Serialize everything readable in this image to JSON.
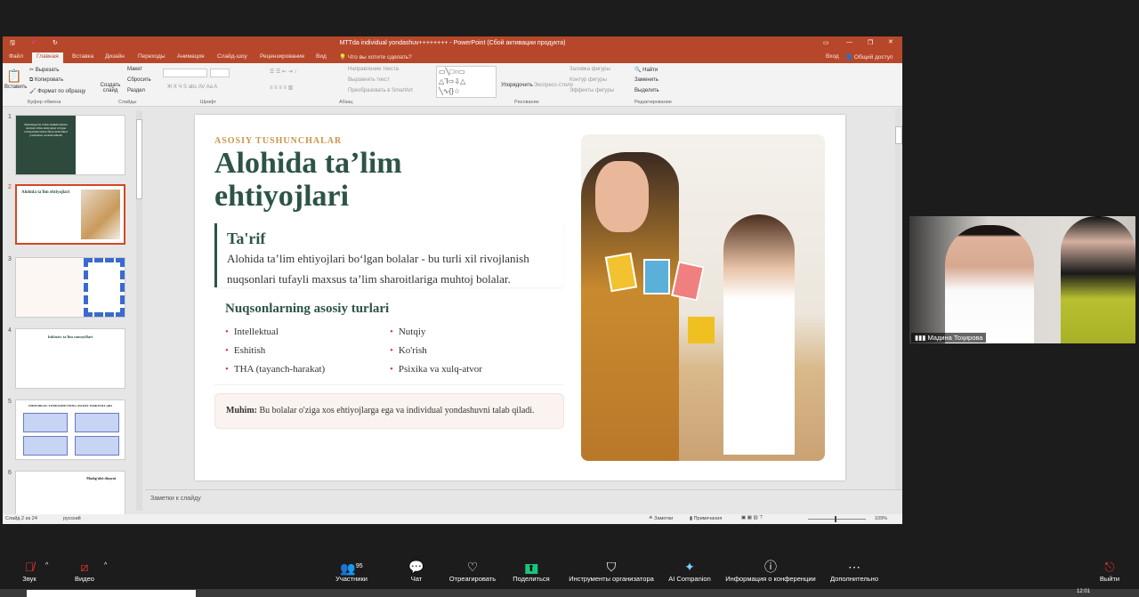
{
  "window": {
    "title": "MTTda individual yondashuv++++++++ - PowerPoint (Сбой активации продукта)",
    "signin": "Вход",
    "share": "Общий доступ"
  },
  "tabs": [
    "Файл",
    "Главная",
    "Вставка",
    "Дизайн",
    "Переходы",
    "Анимация",
    "Слайд-шоу",
    "Рецензирование",
    "Вид"
  ],
  "tell_me": "Что вы хотите сделать?",
  "ribbon": {
    "clipboard": {
      "paste": "Вставить",
      "cut": "Вырезать",
      "copy": "Копировать",
      "format": "Формат по образцу",
      "label": "Буфер обмена"
    },
    "slides": {
      "new": "Создать слайд",
      "layout": "Макет",
      "reset": "Сбросить",
      "section": "Раздел",
      "label": "Слайды"
    },
    "font": {
      "label": "Шрифт"
    },
    "paragraph": {
      "dir": "Направление текста",
      "align": "Выровнять текст",
      "smartart": "Преобразовать в SmartArt",
      "label": "Абзац"
    },
    "drawing": {
      "arrange": "Упорядочить",
      "styles": "Экспресс-стили",
      "fill": "Заливка фигуры",
      "outline": "Контур фигуры",
      "effects": "Эффекты фигуры",
      "label": "Рисование"
    },
    "editing": {
      "find": "Найти",
      "replace": "Заменить",
      "select": "Выделить",
      "label": "Редактирование"
    }
  },
  "thumbnails": [
    {
      "num": "1",
      "title": "Maktabgacha ta'lim tashkilotlarida alohida ta'lim ehtiyojlari bo'lgan tarbiyalanuvchilar bilan individual yondashuv asosida ishlash"
    },
    {
      "num": "2",
      "title": "Alohida ta'lim ehtiyojlari"
    },
    {
      "num": "3",
      "title": ""
    },
    {
      "num": "4",
      "title": "Inkluziv ta'lim tamoyillari"
    },
    {
      "num": "5",
      "title": "INDIVIDUAL YONDASHUVNING ASOSIY TAMOYILLARI"
    },
    {
      "num": "6",
      "title": "Mashg'ulot dizayni"
    }
  ],
  "slide": {
    "kicker": "ASOSIY TUSHUNCHALAR",
    "title_line1": "Alohida ta’lim",
    "title_line2": "ehtiyojlari",
    "def_heading": "Ta'rif",
    "def_line1": "Alohida ta’lim ehtiyojlari bo‘lgan bolalar - bu turli xil rivojlanish",
    "def_line2": "nuqsonlari tufayli maxsus ta’lim sharoitlariga muhtoj bolalar.",
    "types_heading": "Nuqsonlarning asosiy turlari",
    "types_left": [
      "Intellektual",
      "Eshitish",
      "THA (tayanch-harakat)"
    ],
    "types_right": [
      "Nutqiy",
      "Ko'rish",
      "Psixika va xulq-atvor"
    ],
    "note_bold": "Muhim:",
    "note_text": "Bu bolalar o'ziga xos ehtiyojlarga ega va individual yondashuvni talab qiladi.",
    "colors": {
      "title": "#2d5446",
      "kicker": "#c9944a",
      "bullet": "#c0435a",
      "note_bg": "#fbf3ef"
    }
  },
  "notes_placeholder": "Заметки к слайду",
  "status": {
    "slide": "Слайд 2 из 24",
    "lang": "русский",
    "notes": "Заметки",
    "comments": "Примечания",
    "zoom": "109%"
  },
  "video": {
    "participant": "Мадина Тоҳирова"
  },
  "zoom_toolbar": {
    "audio": "Звук",
    "video": "Видео",
    "participants": "Участники",
    "participants_count": "95",
    "chat": "Чат",
    "react": "Отреагировать",
    "share": "Поделиться",
    "host_tools": "Инструменты организатора",
    "ai": "AI Companion",
    "info": "Информация о конференции",
    "more": "Дополнительно",
    "leave": "Выйти"
  },
  "clock": "12:01"
}
